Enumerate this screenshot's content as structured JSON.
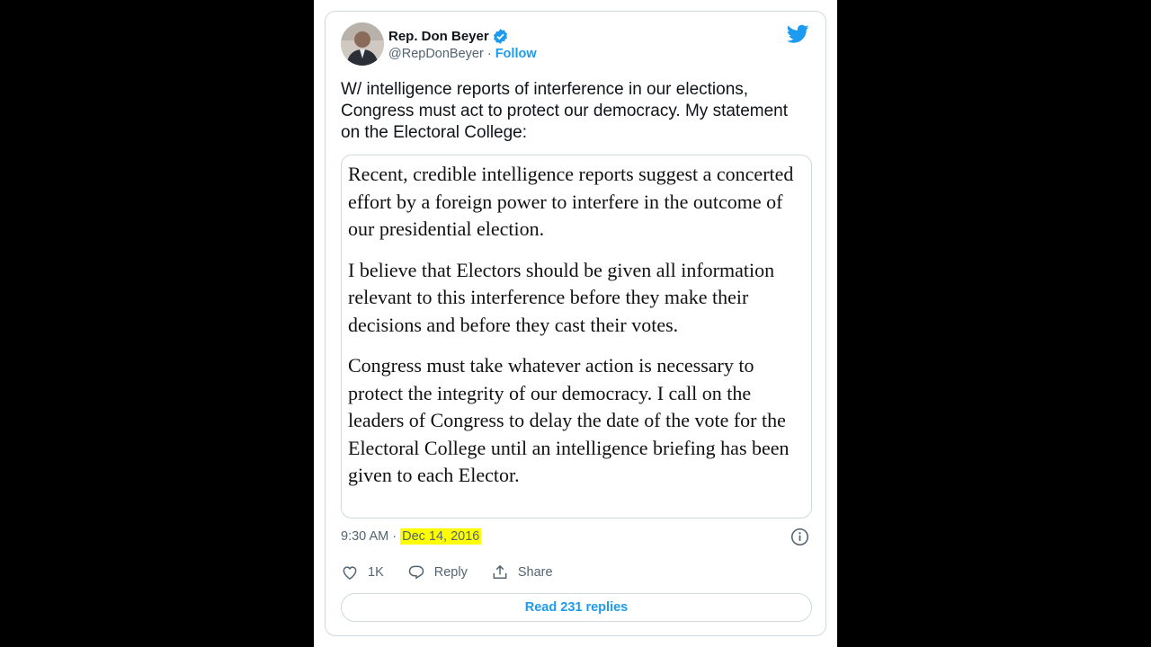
{
  "tweet": {
    "display_name": "Rep. Don Beyer",
    "handle": "@RepDonBeyer",
    "separator": " · ",
    "follow_label": "Follow",
    "text": "W/ intelligence reports of interference in our elections, Congress must act to protect our democracy. My statement on the Electoral College:",
    "statement": {
      "p1": "Recent, credible intelligence reports suggest a concerted effort by a foreign power to interfere in the outcome of our presidential election.",
      "p2": "I believe that Electors should be given all information relevant to this interference before they make their decisions and before they cast their votes.",
      "p3": "Congress must take whatever action is necessary to protect the integrity of our democracy. I call on the leaders of Congress to delay the date of the vote for the Electoral College until an intelligence briefing has been given to each Elector."
    },
    "time": "9:30 AM",
    "date": "Dec 14, 2016",
    "highlight_color": "#ffff00",
    "likes": "1K",
    "reply_label": "Reply",
    "share_label": "Share",
    "read_replies_label": "Read 231 replies",
    "icons": [
      "verified-badge-icon",
      "twitter-bird-icon",
      "info-icon",
      "heart-icon",
      "reply-icon",
      "share-icon"
    ],
    "accent_color": "#1d9bf0"
  }
}
